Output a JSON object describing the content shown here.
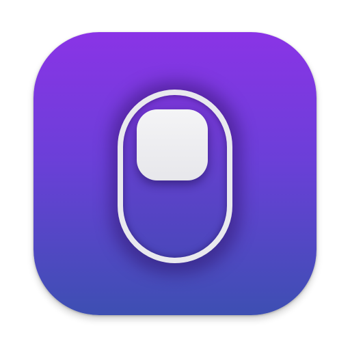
{
  "icon": {
    "name": "toggle-switch-app-icon",
    "background_gradient": [
      "#8a34e6",
      "#3d4fb2"
    ],
    "switch_frame_color": "#e9e9ee",
    "knob_color": "#f1f1f4",
    "switch_state": "on"
  }
}
